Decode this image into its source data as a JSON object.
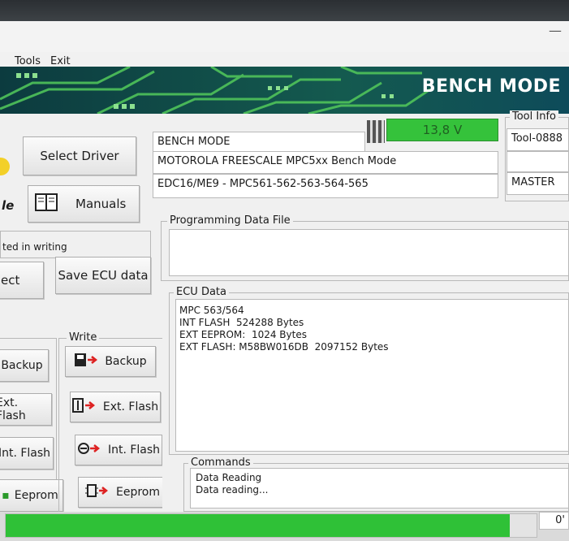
{
  "menu": {
    "tools": "Tools",
    "exit": "Exit"
  },
  "banner": {
    "title": "BENCH MODE"
  },
  "left": {
    "select_driver": "Select Driver",
    "manuals": "Manuals",
    "partial_side_label": "le",
    "status_partial": "ted in writing",
    "connect_partial": "ect",
    "save_ecu": "Save ECU data"
  },
  "read": {
    "backup": "Backup",
    "ext_flash": "Ext. Flash",
    "int_flash": "Int. Flash",
    "eeprom": "Eeprom"
  },
  "write": {
    "legend": "Write",
    "backup": "Backup",
    "ext_flash": "Ext. Flash",
    "int_flash": "Int. Flash",
    "eeprom": "Eeprom"
  },
  "info": {
    "mode": "BENCH MODE",
    "voltage": "13,8 V",
    "protocol": "MOTOROLA FREESCALE MPC5xx Bench Mode",
    "ecu": "EDC16/ME9 - MPC561-562-563-564-565"
  },
  "tool_info": {
    "legend": "Tool Info",
    "id": "Tool-0888",
    "role": "MASTER"
  },
  "programming": {
    "legend": "Programming Data File"
  },
  "ecu_data": {
    "legend": "ECU Data",
    "lines": [
      "MPC 563/564",
      "INT FLASH  524288 Bytes",
      "EXT EEPROM:  1024 Bytes",
      "EXT FLASH: M58BW016DB  2097152 Bytes"
    ]
  },
  "commands": {
    "legend": "Commands",
    "lines": [
      "Data Reading",
      "Data reading..."
    ]
  },
  "progress": {
    "value": "0'",
    "fraction": 0.95
  },
  "colors": {
    "banner": "#0f3d46",
    "circuit": "#4fc35a",
    "voltage": "#35c23b",
    "progress": "#2fc137"
  }
}
